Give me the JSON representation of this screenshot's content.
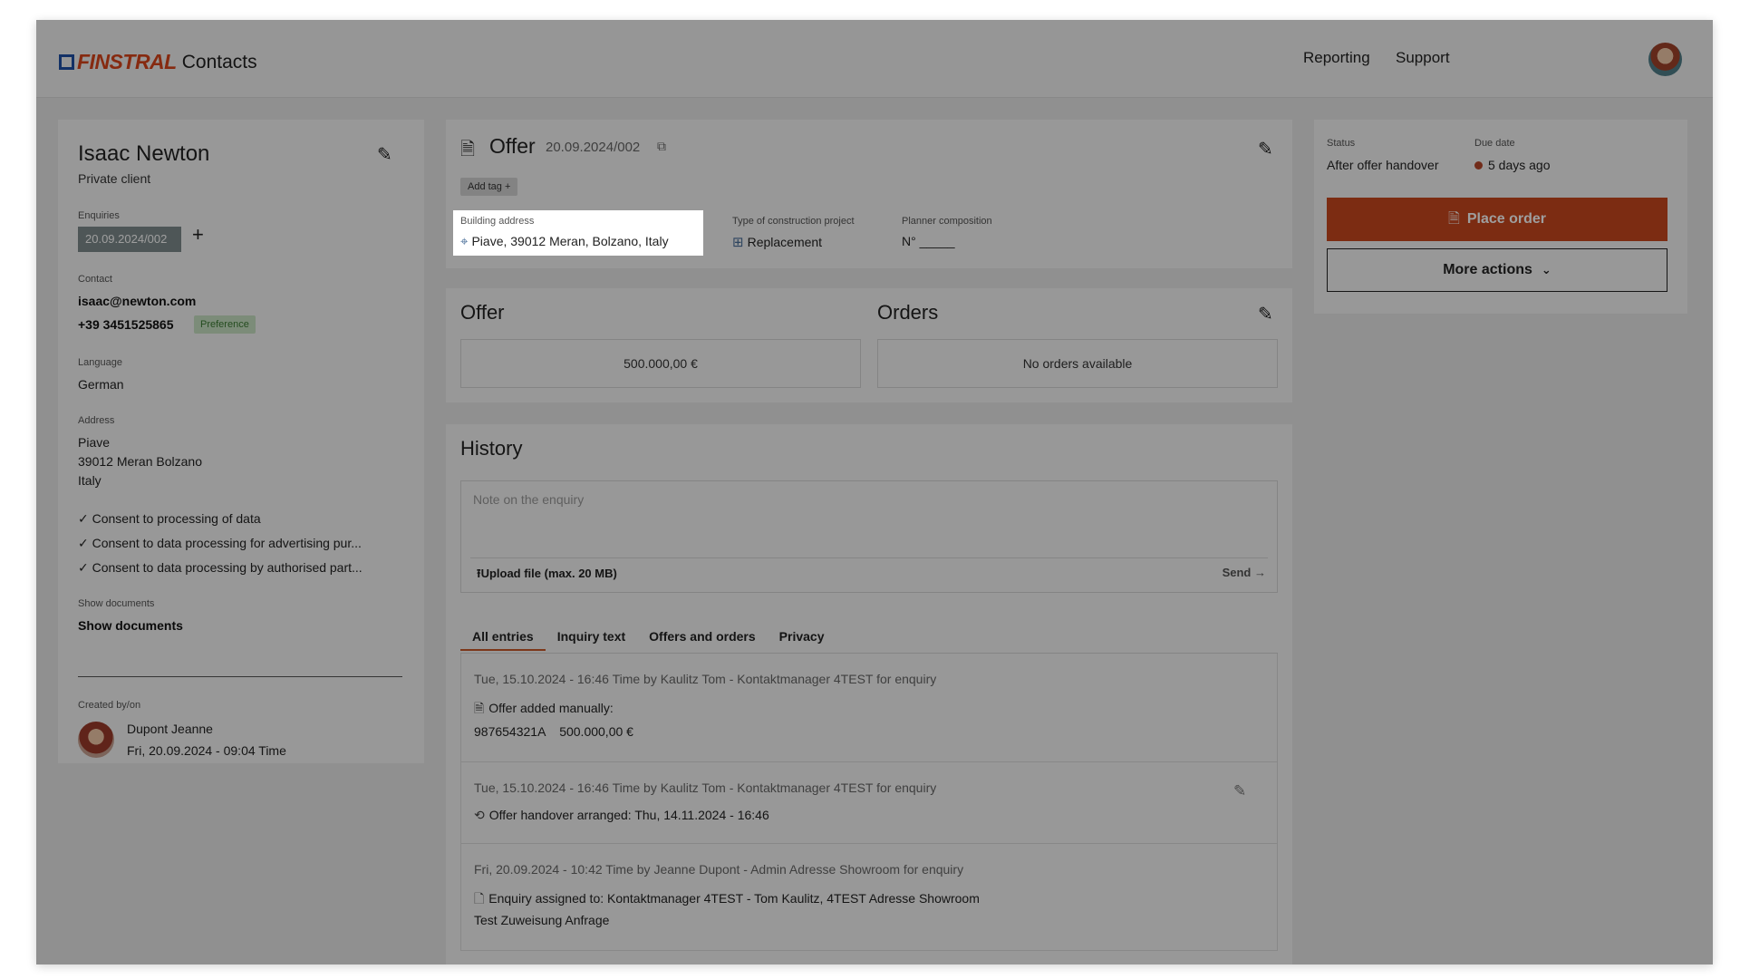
{
  "topbar": {
    "brand": "FINSTRAL",
    "app_title": "Contacts",
    "nav": [
      "Reporting",
      "Support"
    ]
  },
  "contact": {
    "name": "Isaac Newton",
    "client_type": "Private client",
    "enquiries_label": "Enquiries",
    "enquiry_id": "20.09.2024/002",
    "contact_label": "Contact",
    "email": "isaac@newton.com",
    "phone": "+39 3451525865",
    "preference_badge": "Preference",
    "language_label": "Language",
    "language": "German",
    "address_label": "Address",
    "address_lines": [
      "Piave",
      "39012 Meran Bolzano",
      "Italy"
    ],
    "consents": [
      "Consent to processing of data",
      "Consent to data processing for advertising pur...",
      "Consent to data processing by authorised part..."
    ],
    "documents_label": "Show documents",
    "documents_link": "Show documents",
    "created_label": "Created by/on",
    "created_by": "Dupont Jeanne",
    "created_on": "Fri, 20.09.2024 - 09:04 Time"
  },
  "offer_header": {
    "title": "Offer",
    "number": "20.09.2024/002",
    "add_tag": "Add tag +",
    "building_address_label": "Building address",
    "building_address": "Piave, 39012 Meran, Bolzano, Italy",
    "construction_label": "Type of construction project",
    "construction_value": "Replacement",
    "planner_label": "Planner composition",
    "planner_value": "N° _____"
  },
  "summary": {
    "offer_title": "Offer",
    "offer_value": "500.000,00 €",
    "orders_title": "Orders",
    "orders_value": "No orders available"
  },
  "history": {
    "title": "History",
    "note_placeholder": "Note on the enquiry",
    "upload_label": "Upload file (max. 20 MB)",
    "send_label": "Send →",
    "tabs": [
      "All entries",
      "Inquiry text",
      "Offers and orders",
      "Privacy"
    ],
    "entries": [
      {
        "meta": "Tue, 15.10.2024 - 16:46 Time by Kaulitz Tom - Kontaktmanager 4TEST for enquiry",
        "line1": "Offer added manually:",
        "line2": "987654321A    500.000,00 €"
      },
      {
        "meta": "Tue, 15.10.2024 - 16:46 Time by Kaulitz Tom - Kontaktmanager 4TEST for enquiry",
        "line1": "Offer handover arranged: Thu, 14.11.2024 - 16:46"
      },
      {
        "meta": "Fri, 20.09.2024 - 10:42 Time by Jeanne Dupont - Admin Adresse Showroom for enquiry",
        "line1": "Enquiry assigned to: Kontaktmanager 4TEST - Tom Kaulitz, 4TEST Adresse Showroom",
        "line2": "Test Zuweisung Anfrage"
      }
    ]
  },
  "status_panel": {
    "status_label": "Status",
    "status_value": "After offer handover",
    "due_label": "Due date",
    "due_value": "5 days ago",
    "place_order": "Place order",
    "more_actions": "More actions"
  },
  "colors": {
    "accent": "#c9471e",
    "brand_blue": "#1f4fa5",
    "badge_green": "#c9e3c4",
    "overlay": "rgba(0,0,0,0.38)"
  }
}
